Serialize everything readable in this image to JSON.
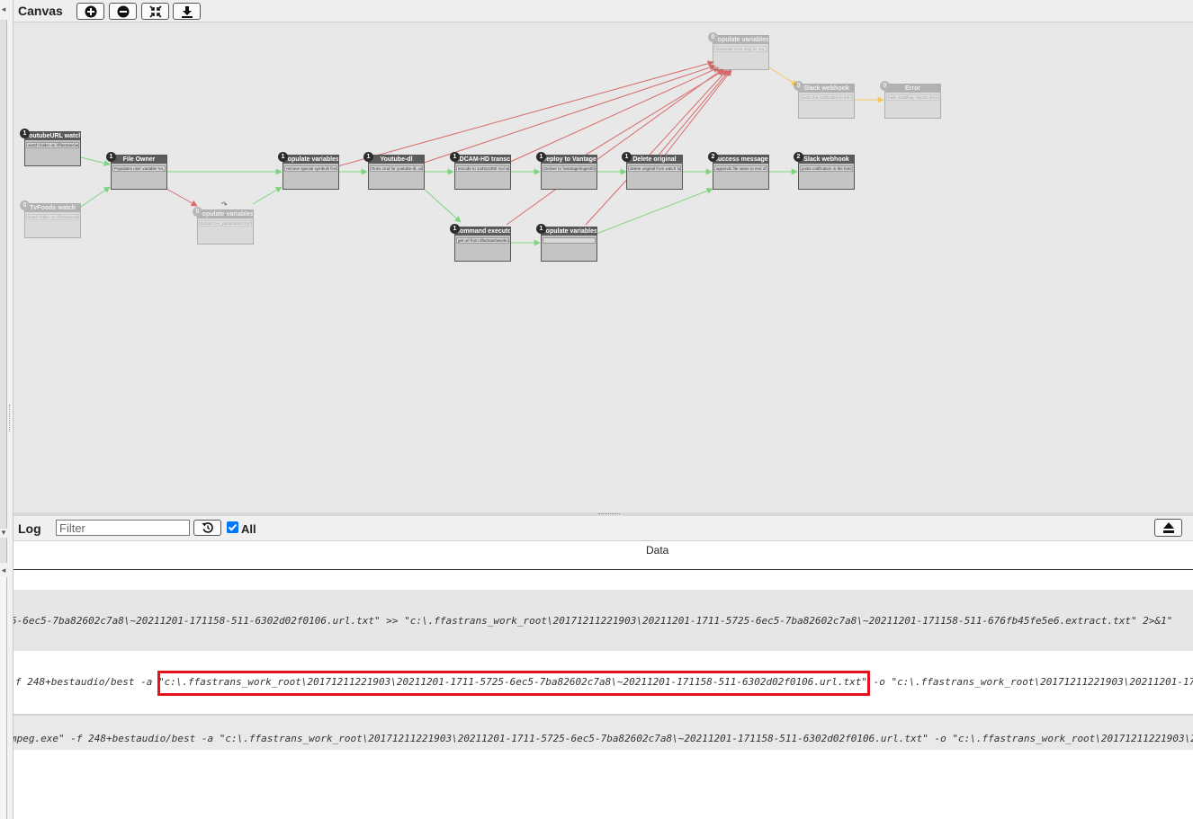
{
  "canvas": {
    "title": "Canvas",
    "toolbar": [
      {
        "name": "zoom-in-icon"
      },
      {
        "name": "zoom-out-icon"
      },
      {
        "name": "fit-to-screen-icon"
      },
      {
        "name": "download-icon"
      }
    ],
    "nodes": [
      {
        "id": "youtube-url-watch",
        "badge": "1",
        "title": "YoutubeURL watch",
        "desc": "watch folder on \\\\ffastrans\\watchfolders\\youtube",
        "ghost": false
      },
      {
        "id": "tvfoods-watch",
        "badge": "0",
        "title": "TvFoods watch",
        "desc": "watch folder on \\\\ffastrans\\watchfolders\\tvfoods",
        "ghost": true
      },
      {
        "id": "file-owner",
        "badge": "1",
        "title": "File Owner",
        "desc": "Populates user variable %s_owner",
        "ghost": false
      },
      {
        "id": "populate-variables-ghost",
        "badge": "0",
        "title": "Populate variables",
        "desc": "Extract %s_parameters from source name",
        "ghost": true
      },
      {
        "id": "populate-variables-1",
        "badge": "1",
        "title": "Populate variables",
        "desc": "remove special symbols from input",
        "ghost": false
      },
      {
        "id": "youtube-dl",
        "badge": "1",
        "title": "Youtube-dl",
        "desc": "Runs cmd for youtube-dl, uses url",
        "ghost": false
      },
      {
        "id": "xdcam-hd-transcode",
        "badge": "1",
        "title": "XDCAM-HD transcode",
        "desc": "encode to 1440x1080 mxf with",
        "ghost": false
      },
      {
        "id": "deploy-to-vantage",
        "badge": "1",
        "title": "Deploy to Vantage",
        "desc": "Deliver to \\\\vantage\\ingest\\fast",
        "ghost": false
      },
      {
        "id": "delete-original",
        "badge": "1",
        "title": "Delete original",
        "desc": "delete original from watch folder",
        "ghost": false
      },
      {
        "id": "success-message",
        "badge": "2",
        "title": "Success message",
        "desc": "appends file name to end of success",
        "ghost": false
      },
      {
        "id": "slack-webhook-1",
        "badge": "2",
        "title": "Slack webhook",
        "desc": "posts notification in the bots channel",
        "ghost": false
      },
      {
        "id": "command-executor",
        "badge": "1",
        "title": "Command executor",
        "desc": "get url from dfastrans\\workroot",
        "ghost": false
      },
      {
        "id": "populate-variables-2",
        "badge": "1",
        "title": "Populate variables",
        "desc": "",
        "ghost": false
      },
      {
        "id": "populate-variables-error",
        "badge": "0",
        "title": "Populate variables",
        "desc": "Generate error msg for %s_errormsg",
        "ghost": true
      },
      {
        "id": "slack-webhook-ghost",
        "badge": "0",
        "title": "Slack webhook",
        "desc": "posts the notification in the bots",
        "ghost": true
      },
      {
        "id": "error-node",
        "badge": "0",
        "title": "Error",
        "desc": "Fails workflow, reports error msg",
        "ghost": true
      }
    ]
  },
  "log": {
    "title": "Log",
    "filter_placeholder": "Filter",
    "filter_value": "",
    "all_label": "All",
    "all_checked": true,
    "column_header": "Data",
    "rows": [
      "5-6ec5-7ba82602c7a8\\~20211201-171158-511-6302d02f0106.url.txt\" >> \"c:\\.ffastrans_work_root\\20171211221903\\20211201-1711-5725-6ec5-7ba82602c7a8\\~20211201-171158-511-676fb45fe5e6.extract.txt\" 2>&1\"",
      "f 248+bestaudio/best -a \"c:\\.ffastrans_work_root\\20171211221903\\20211201-1711-5725-6ec5-7ba82602c7a8\\~20211201-171158-511-6302d02f0106.url.txt\" -o \"c:\\.ffastrans_work_root\\20171211221903\\20211201-1711",
      "mpeg.exe\" -f 248+bestaudio/best -a \"c:\\.ffastrans_work_root\\20171211221903\\20211201-1711-5725-6ec5-7ba82602c7a8\\~20211201-171158-511-6302d02f0106.url.txt\" -o \"c:\\.ffastrans_work_root\\20171211221903\\20"
    ]
  },
  "colors": {
    "success_edge": "#7fd37f",
    "error_edge": "#d86a6a",
    "warn_edge": "#f3c95a",
    "highlight": "#e3121e",
    "checkbox": "#0075ff"
  }
}
